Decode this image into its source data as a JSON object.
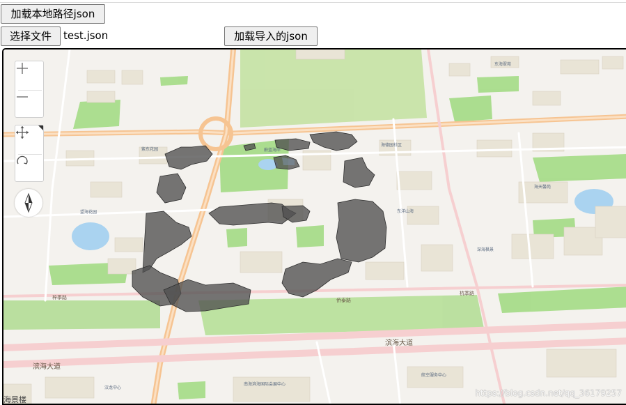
{
  "toolbar": {
    "load_local_label": "加载本地路径json",
    "choose_file_label": "选择文件",
    "file_name": "test.json",
    "load_import_label": "加载导入的json"
  },
  "map": {
    "controls": {
      "zoom_in_icon": "plus-icon",
      "zoom_out_icon": "minus-icon",
      "pan_icon": "move-icon",
      "rotate_icon": "rotate-icon",
      "compass_icon": "compass-icon"
    },
    "road_labels": {
      "binhai_avenue_right": "滨海大道",
      "binhai_avenue_left": "滨海大道",
      "yangshao_road": "梓季路",
      "hanging_road": "杭季路",
      "qiaotai_road": "侨泰路"
    },
    "poi_labels": {
      "donglinghua_garden": "紫东花园",
      "garden_community": "蔚蓝海岸",
      "tower_park": "东海翠苑",
      "community_center": "海德园社区",
      "east_pavilion": "东洋山海",
      "south_pavilion": "深海枫景",
      "bay_north": "海天馨苑",
      "bay_west": "望海花园",
      "hanlu_community": "汉龙中心",
      "navy_center": "航空服务中心",
      "bottom_left_label": "海景楼",
      "center_bottom_label": "南海滨海国际会展中心"
    },
    "watermark": "https://blog.csdn.net/qq_36179257",
    "colors": {
      "water": "#aad3f0",
      "park": "#a8dc8a",
      "main_road": "#f6c492",
      "building_3d": "#5c5c5c",
      "background": "#f4f2ee"
    }
  }
}
